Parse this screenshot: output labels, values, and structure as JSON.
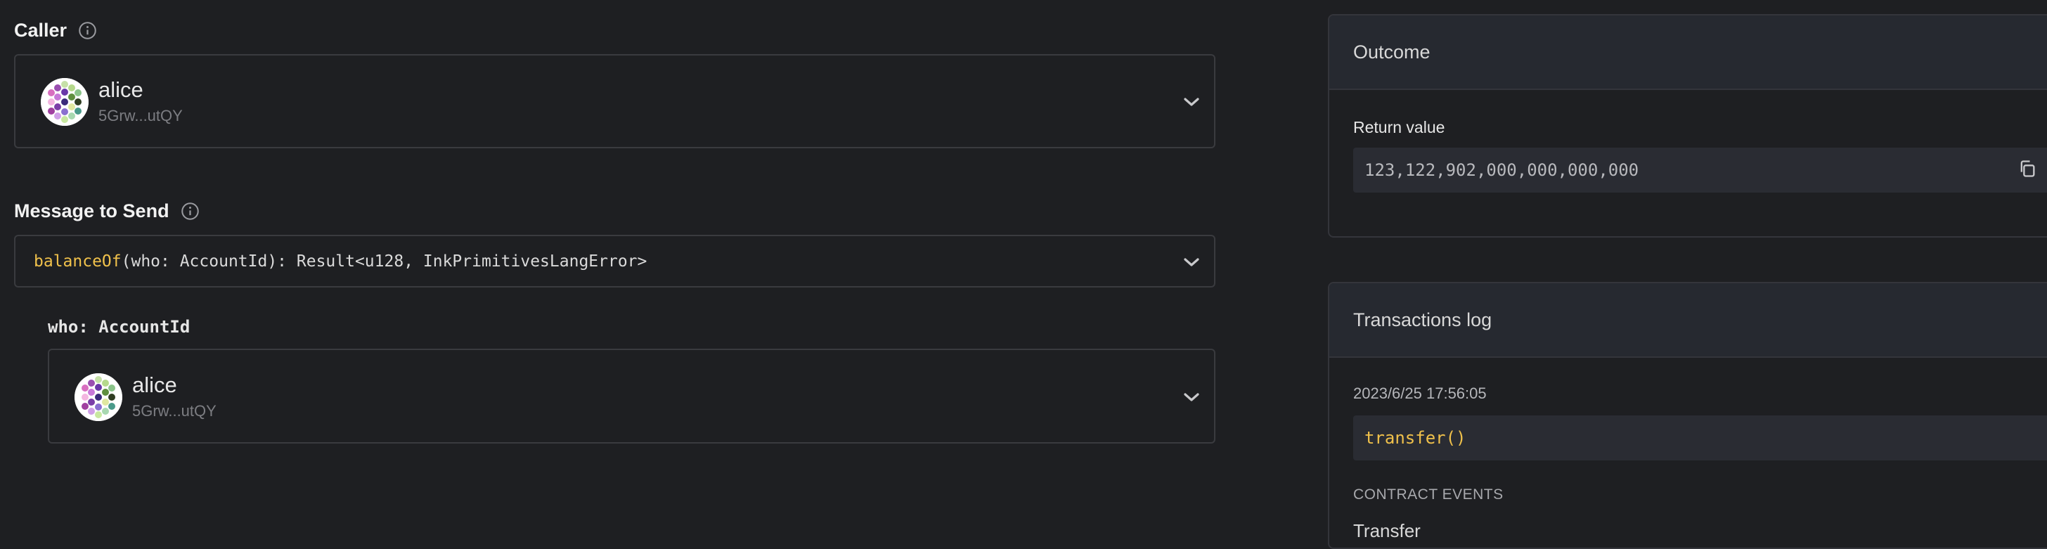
{
  "caller": {
    "label": "Caller",
    "name": "alice",
    "address": "5Grw...utQY"
  },
  "message": {
    "label": "Message to Send",
    "fn_name": "balanceOf",
    "signature": "(who: AccountId): Result<u128, InkPrimitivesLangError>"
  },
  "param": {
    "label": "who: AccountId",
    "name": "alice",
    "address": "5Grw...utQY"
  },
  "outcome": {
    "title": "Outcome",
    "return_label": "Return value",
    "return_value": "123,122,902,000,000,000,000"
  },
  "txlog": {
    "title": "Transactions log",
    "timestamp": "2023/6/25 17:56:05",
    "call": "transfer()",
    "events_label": "CONTRACT EVENTS",
    "event_name": "Transfer"
  },
  "colors": {
    "accent": "#f0c14b",
    "background": "#1e1f22",
    "panel_header": "#262930"
  }
}
